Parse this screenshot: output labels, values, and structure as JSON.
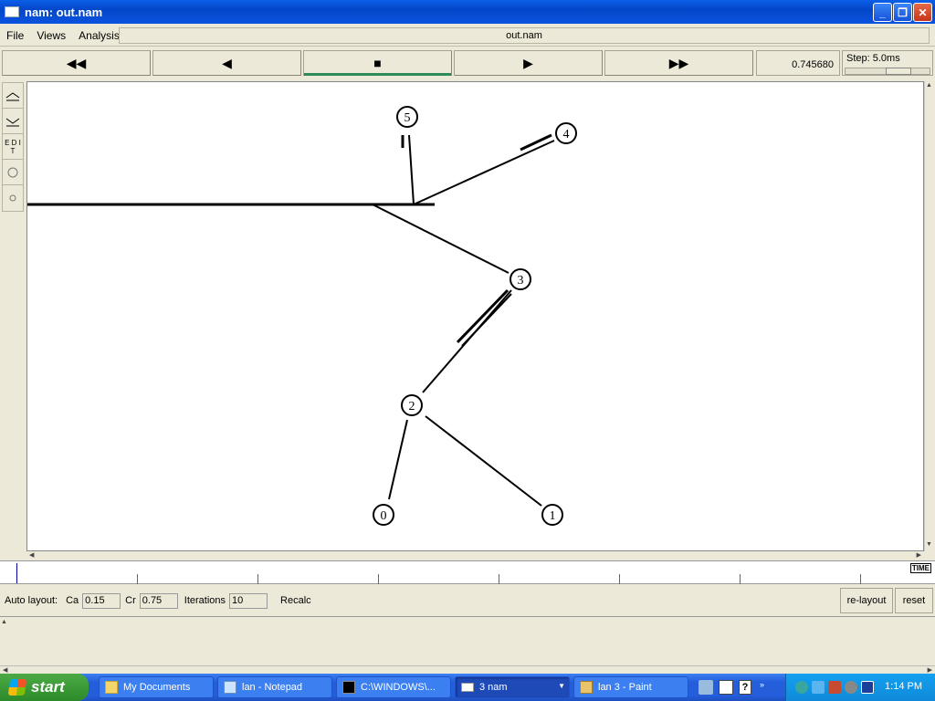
{
  "window": {
    "title": "nam: out.nam"
  },
  "menu": {
    "items": [
      "File",
      "Views",
      "Analysis"
    ],
    "file_label": "out.nam"
  },
  "controls": {
    "buttons": [
      {
        "name": "fast-rewind-button",
        "glyph": "◀◀"
      },
      {
        "name": "rewind-button",
        "glyph": "◀"
      },
      {
        "name": "stop-button",
        "glyph": "■"
      },
      {
        "name": "play-button",
        "glyph": "▶"
      },
      {
        "name": "fast-forward-button",
        "glyph": "▶▶"
      }
    ],
    "time": "0.745680",
    "step_label": "Step: 5.0ms"
  },
  "tools": {
    "edit_label": "E D I T"
  },
  "network": {
    "nodes": [
      {
        "id": "0",
        "label": "0"
      },
      {
        "id": "1",
        "label": "1"
      },
      {
        "id": "2",
        "label": "2"
      },
      {
        "id": "3",
        "label": "3"
      },
      {
        "id": "4",
        "label": "4"
      },
      {
        "id": "5",
        "label": "5"
      }
    ]
  },
  "timeline": {
    "label": "TIME"
  },
  "autolayout": {
    "label": "Auto layout:",
    "ca_label": "Ca",
    "ca_value": "0.15",
    "cr_label": "Cr",
    "cr_value": "0.75",
    "iterations_label": "Iterations",
    "iterations_value": "10",
    "recalc_label": "Recalc",
    "relayout_label": "re-layout",
    "reset_label": "reset"
  },
  "taskbar": {
    "start_label": "start",
    "tasks": [
      "My Documents",
      "lan - Notepad",
      "C:\\WINDOWS\\...",
      "3 nam",
      "lan 3 - Paint"
    ],
    "clock": "1:14 PM"
  }
}
